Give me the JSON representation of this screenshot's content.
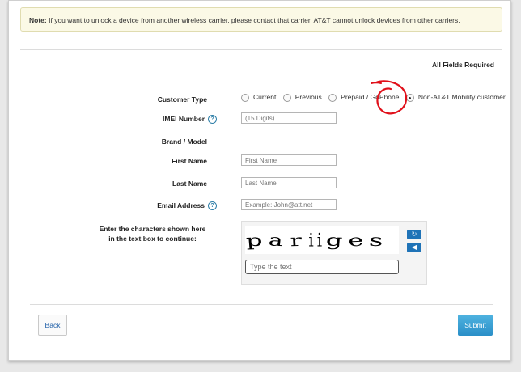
{
  "note": {
    "strong": "Note:",
    "text": "If you want to unlock a device from another wireless carrier, please contact that carrier. AT&T cannot unlock devices from other carriers."
  },
  "form": {
    "required_text": "All Fields Required",
    "customer_type_label": "Customer Type",
    "customer_types": [
      {
        "label": "Current",
        "selected": false
      },
      {
        "label": "Previous",
        "selected": false
      },
      {
        "label": "Prepaid / GoPhone",
        "selected": false
      },
      {
        "label": "Non-AT&T Mobility customer",
        "selected": true
      }
    ],
    "imei_label": "IMEI Number",
    "imei_placeholder": "(15 Digits)",
    "brand_model_label": "Brand / Model",
    "first_name_label": "First Name",
    "first_name_placeholder": "First Name",
    "last_name_label": "Last Name",
    "last_name_placeholder": "Last Name",
    "email_label": "Email Address",
    "email_placeholder": "Example: John@att.net",
    "captcha_label_line1": "Enter the characters shown here",
    "captcha_label_line2": "in the text box to continue:",
    "captcha_chars": [
      "p",
      "a",
      "r",
      "i",
      "i",
      "g",
      "e",
      "s"
    ],
    "captcha_input_placeholder": "Type the text",
    "help_icon": "?"
  },
  "buttons": {
    "back": "Back",
    "submit": "Submit"
  },
  "icons": {
    "help": "question-circle-icon",
    "refresh": "refresh-icon",
    "audio": "audio-play-icon"
  },
  "colors": {
    "accent": "#1f73b7",
    "annotation": "#e0101a",
    "note_bg": "#fbf9e6"
  }
}
